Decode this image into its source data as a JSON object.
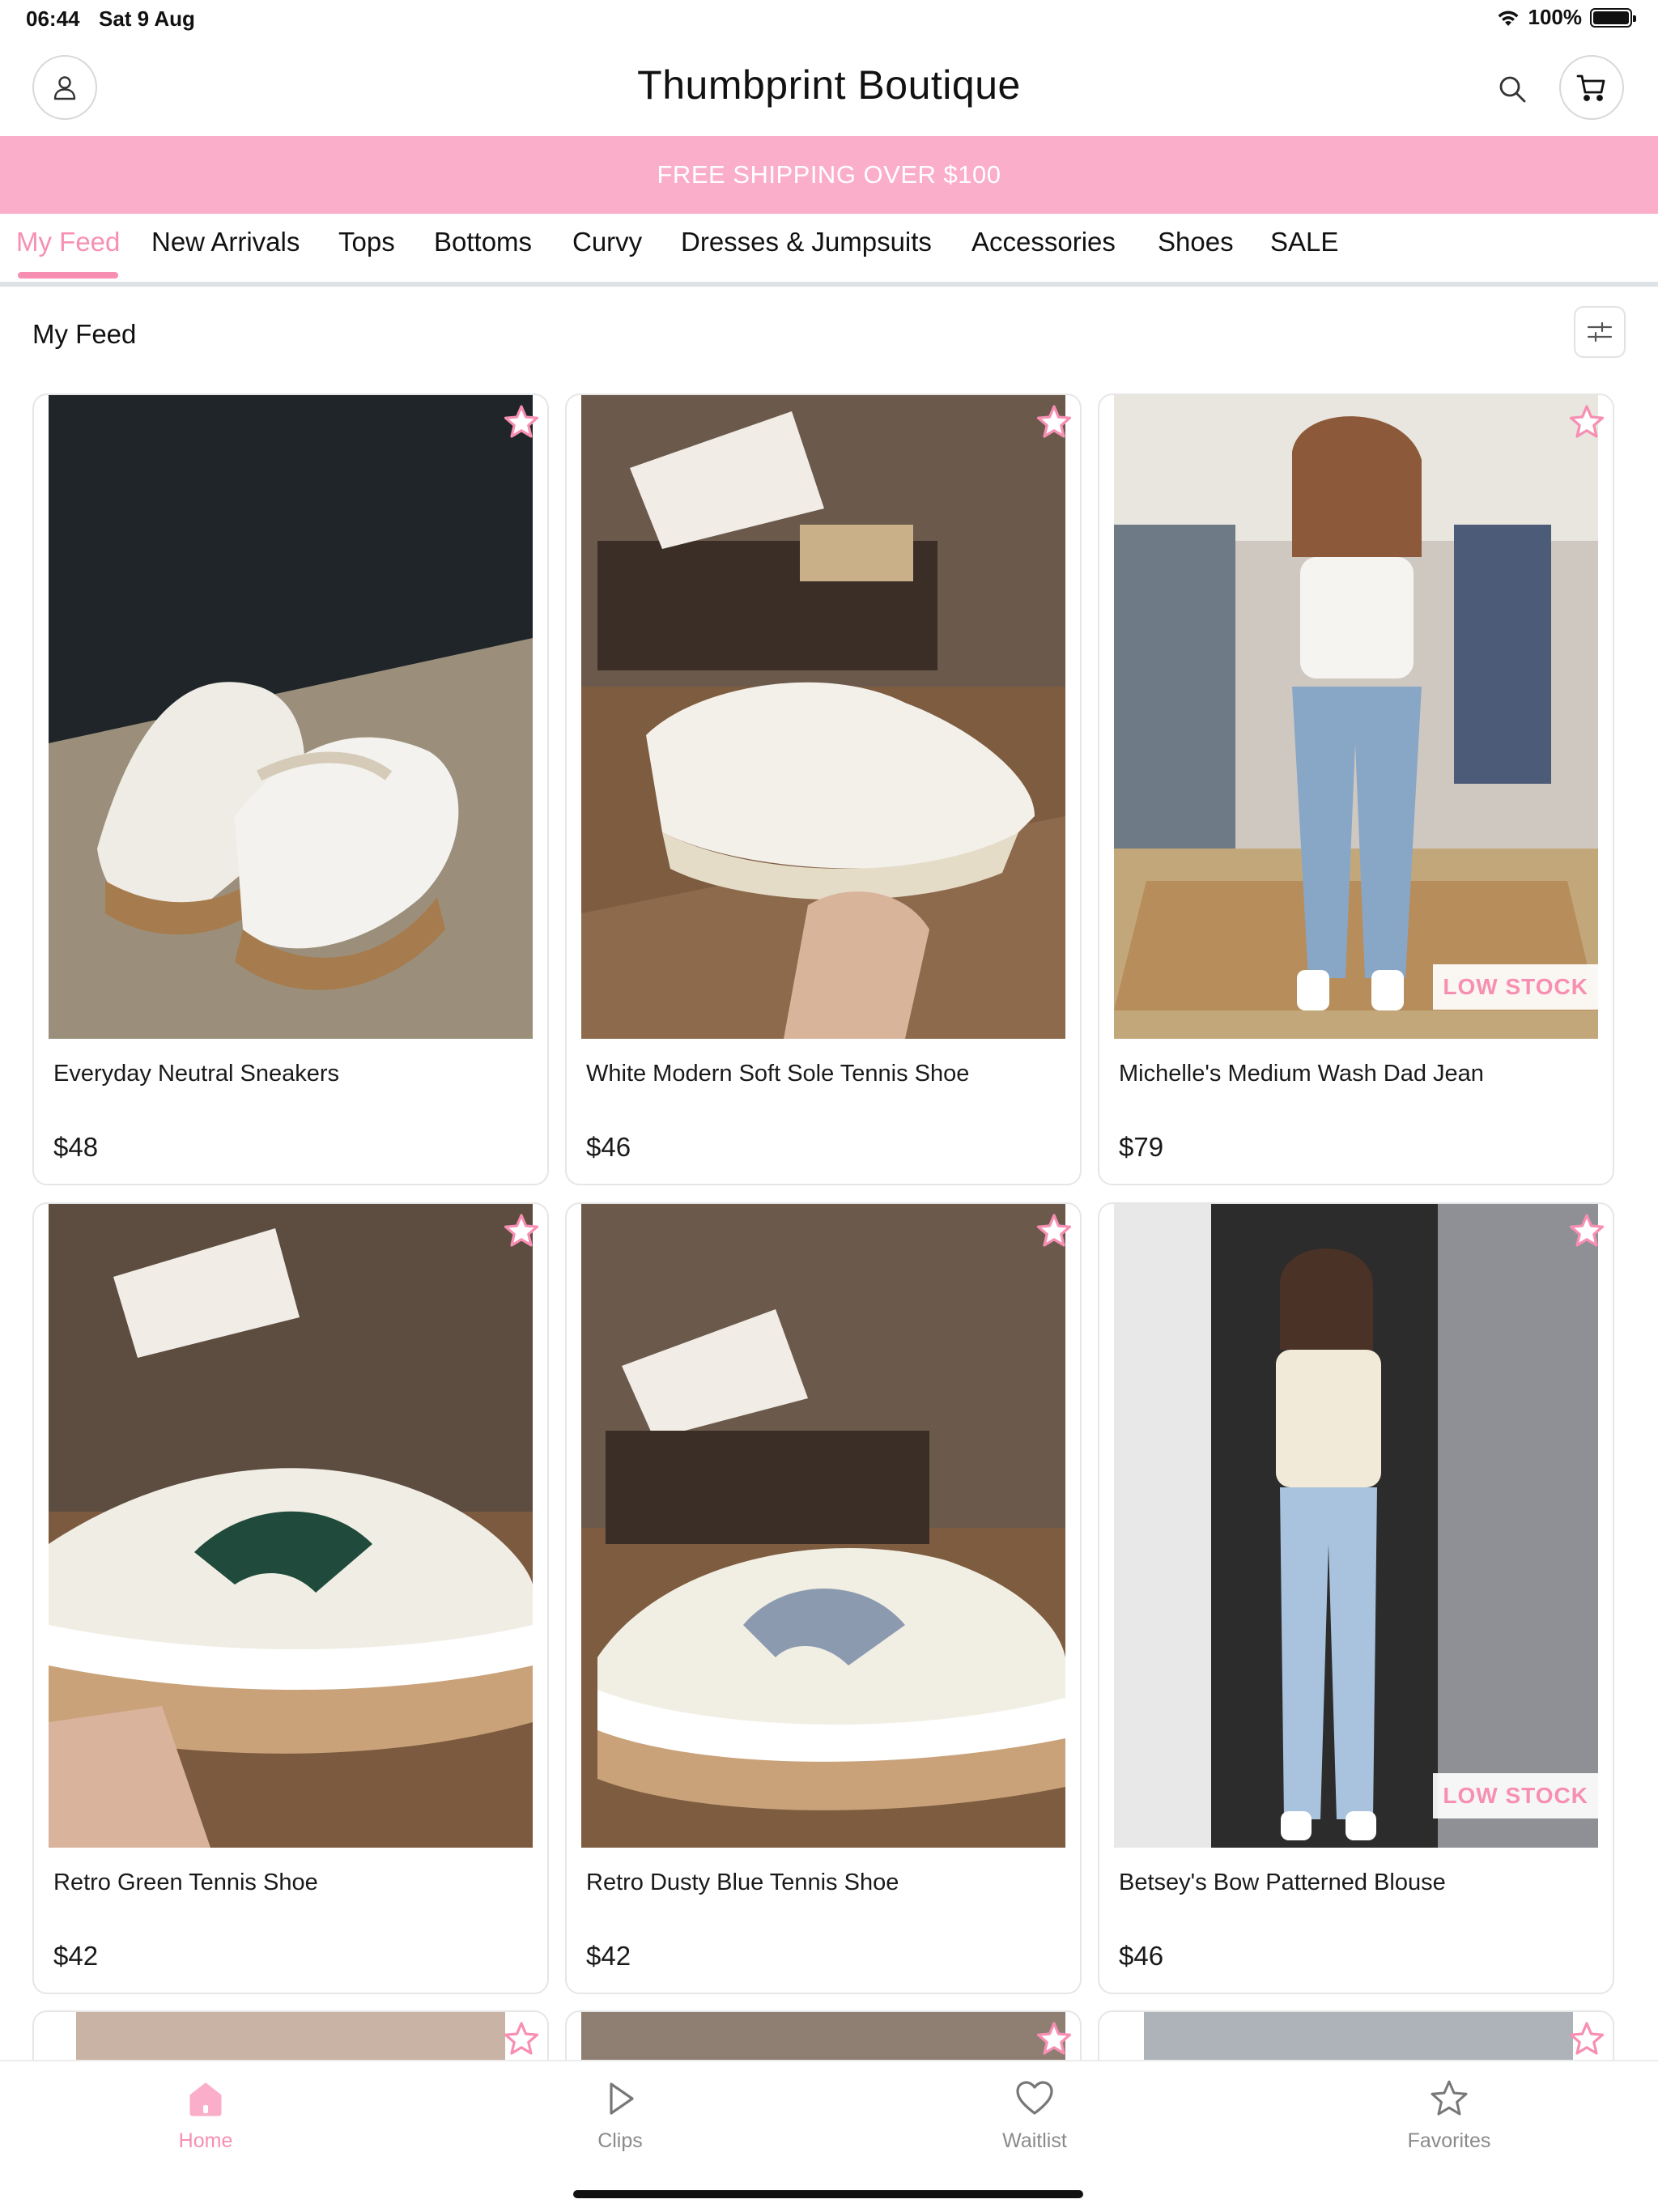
{
  "status_bar": {
    "time": "06:44",
    "date": "Sat 9 Aug",
    "battery": "100%"
  },
  "header": {
    "title": "Thumbprint Boutique"
  },
  "banner": {
    "text": "FREE SHIPPING OVER $100"
  },
  "nav": {
    "tabs": [
      "My Feed",
      "New Arrivals",
      "Tops",
      "Bottoms",
      "Curvy",
      "Dresses & Jumpsuits",
      "Accessories",
      "Shoes",
      "SALE"
    ],
    "active_index": 0
  },
  "section": {
    "title": "My Feed"
  },
  "products": [
    {
      "name": "Everyday Neutral Sneakers",
      "price": "$48",
      "badge": ""
    },
    {
      "name": "White Modern Soft Sole Tennis Shoe",
      "price": "$46",
      "badge": ""
    },
    {
      "name": "Michelle's Medium Wash Dad Jean",
      "price": "$79",
      "badge": "LOW STOCK"
    },
    {
      "name": "Retro Green Tennis Shoe",
      "price": "$42",
      "badge": ""
    },
    {
      "name": "Retro Dusty Blue Tennis Shoe",
      "price": "$42",
      "badge": ""
    },
    {
      "name": "Betsey's Bow Patterned Blouse",
      "price": "$46",
      "badge": "LOW STOCK"
    }
  ],
  "tabbar": {
    "items": [
      {
        "label": "Home",
        "icon": "home-icon"
      },
      {
        "label": "Clips",
        "icon": "play-icon"
      },
      {
        "label": "Waitlist",
        "icon": "heart-icon"
      },
      {
        "label": "Favorites",
        "icon": "star-icon"
      }
    ]
  },
  "colors": {
    "accent": "#f78fb3",
    "banner": "#fbaec9",
    "text": "#1a1a1a",
    "muted": "#8a8a8a"
  }
}
